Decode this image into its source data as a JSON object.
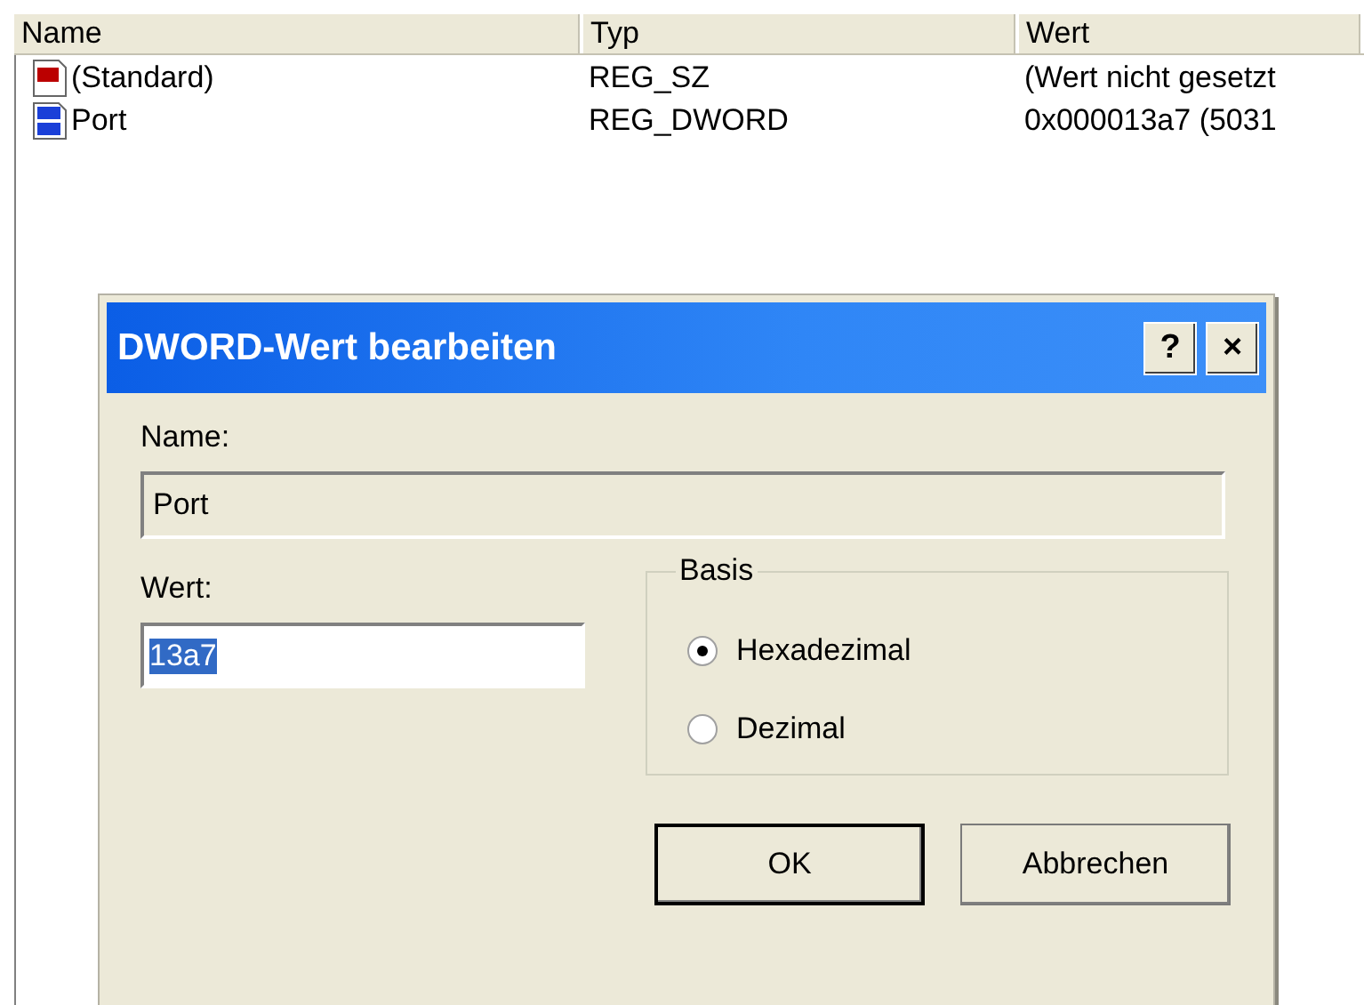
{
  "list": {
    "columns": [
      "Name",
      "Typ",
      "Wert"
    ],
    "rows": [
      {
        "kind": "string",
        "name": "(Standard)",
        "type": "REG_SZ",
        "value": "(Wert nicht gesetzt"
      },
      {
        "kind": "binary",
        "name": "Port",
        "type": "REG_DWORD",
        "value": "0x000013a7 (5031"
      }
    ]
  },
  "dialog": {
    "title": "DWORD-Wert bearbeiten",
    "help": "?",
    "close": "×",
    "name_label": "Name:",
    "name_value": "Port",
    "value_label": "Wert:",
    "value_value": "13a7",
    "value_selected": true,
    "base_label": "Basis",
    "radios": [
      {
        "label": "Hexadezimal",
        "selected": true
      },
      {
        "label": "Dezimal",
        "selected": false
      }
    ],
    "buttons": [
      {
        "label": "OK",
        "default": true
      },
      {
        "label": "Abbrechen",
        "default": false
      }
    ]
  }
}
